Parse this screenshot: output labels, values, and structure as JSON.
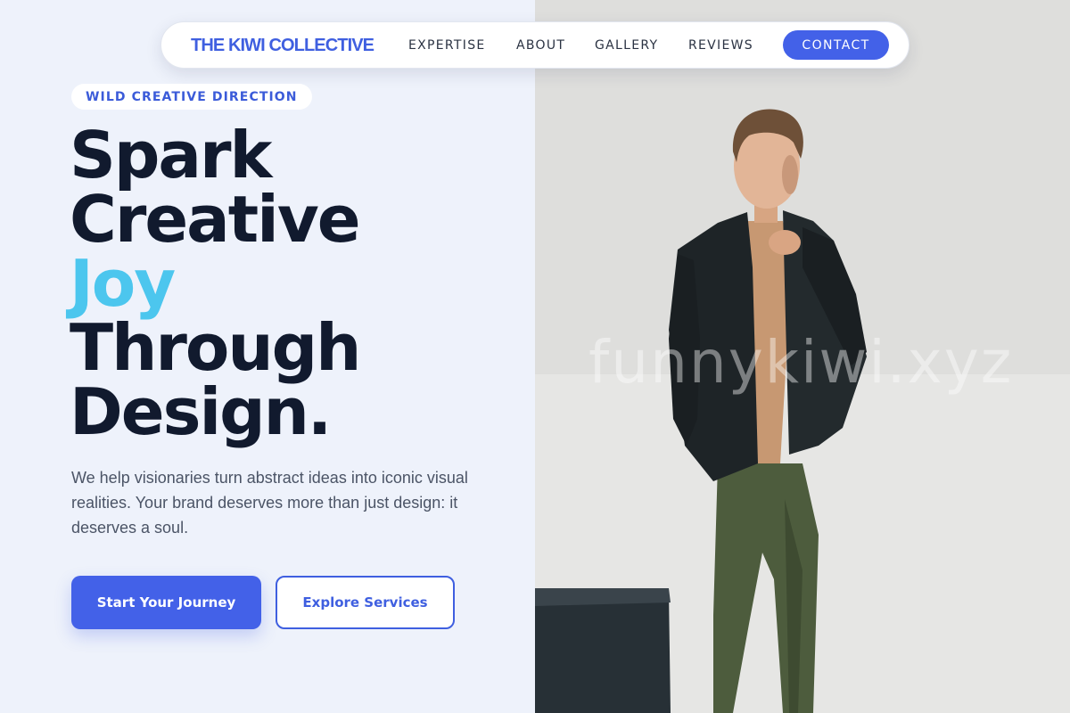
{
  "nav": {
    "brand": "THE KIWI COLLECTIVE",
    "links": [
      "EXPERTISE",
      "ABOUT",
      "GALLERY",
      "REVIEWS"
    ],
    "cta": "CONTACT"
  },
  "hero": {
    "eyebrow": "WILD CREATIVE DIRECTION",
    "headline": [
      "Spark",
      "Creative",
      "Joy",
      "Through",
      "Design."
    ],
    "accent_word": "Joy",
    "description": "We help visionaries turn abstract ideas into iconic visual realities. Your brand deserves more than just design: it deserves a soul.",
    "primary_button": "Start Your Journey",
    "secondary_button": "Explore Services"
  },
  "photo": {
    "watermark": "funnykiwi.xyz"
  },
  "colors": {
    "accent_blue": "#4361e8",
    "accent_cyan": "#4cc6ee",
    "heading": "#111a2e",
    "background": "#eef2fb"
  }
}
